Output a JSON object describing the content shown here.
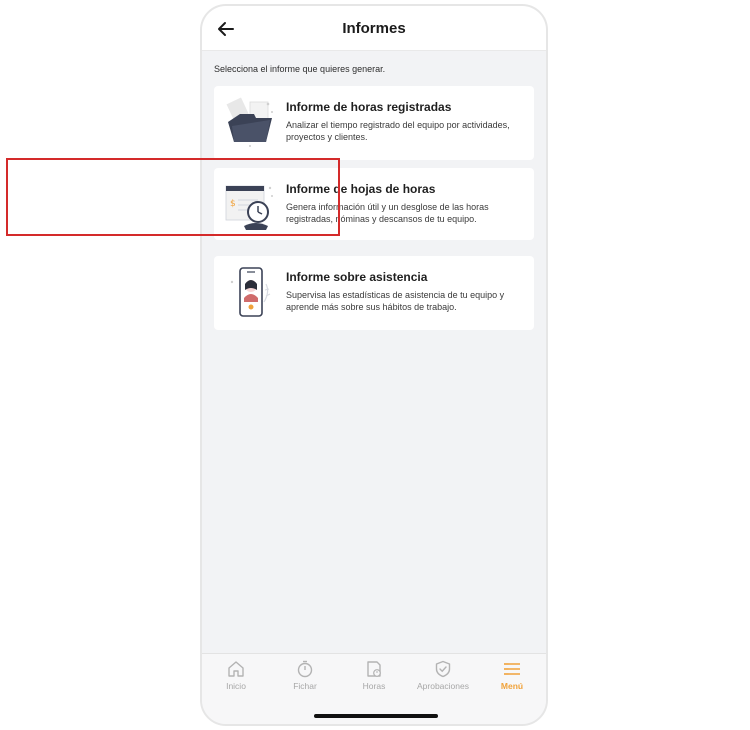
{
  "header": {
    "title": "Informes",
    "back_icon": "arrow-left-icon"
  },
  "subtitle": "Selecciona el informe que quieres generar.",
  "reports": [
    {
      "title": "Informe de horas registradas",
      "description": "Analizar el tiempo registrado del equipo por actividades, proyectos y clientes.",
      "icon": "folder-illustration-icon"
    },
    {
      "title": "Informe de hojas de horas",
      "description": "Genera información útil y un desglose de las horas registradas, nóminas y descansos de tu equipo.",
      "icon": "timesheet-clock-illustration-icon",
      "highlighted": true
    },
    {
      "title": "Informe sobre asistencia",
      "description": "Supervisa las estadísticas de asistencia de tu equipo y aprende más sobre sus hábitos de trabajo.",
      "icon": "phone-person-illustration-icon"
    }
  ],
  "tabbar": {
    "active": "Menú",
    "tabs": [
      {
        "label": "Inicio",
        "icon": "home-icon"
      },
      {
        "label": "Fichar",
        "icon": "stopwatch-icon"
      },
      {
        "label": "Horas",
        "icon": "timesheet-icon"
      },
      {
        "label": "Aprobaciones",
        "icon": "shield-check-icon"
      },
      {
        "label": "Menú",
        "icon": "hamburger-menu-icon"
      }
    ]
  },
  "colors": {
    "accent": "#f0a23a",
    "highlight_border": "#d42a2a",
    "background": "#f2f3f5",
    "card": "#ffffff",
    "illustration_dark": "#3b4256"
  }
}
